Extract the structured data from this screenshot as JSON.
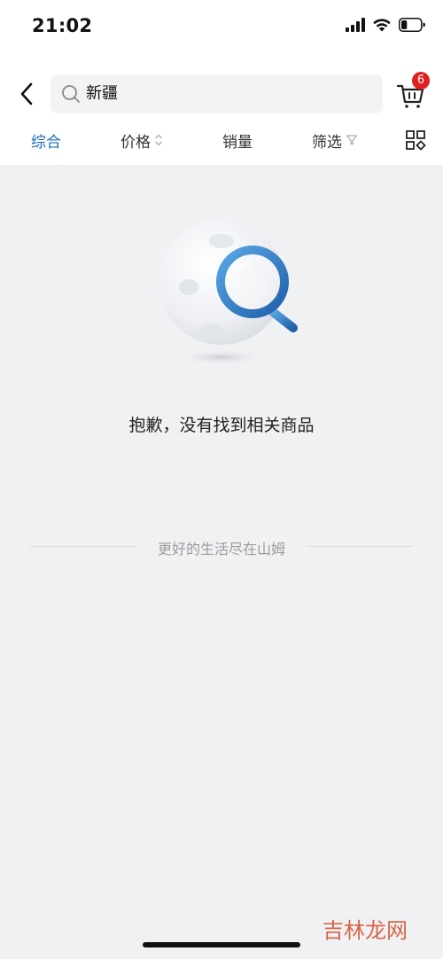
{
  "status_bar": {
    "time": "21:02",
    "icons": [
      "signal-icon",
      "wifi-icon",
      "battery-icon"
    ],
    "battery_level": 0.3
  },
  "search": {
    "query": "新疆",
    "icon": "search-icon"
  },
  "cart": {
    "icon": "cart-icon",
    "badge_count": "6"
  },
  "sort_bar": {
    "items": [
      {
        "label": "综合",
        "active": true
      },
      {
        "label": "价格",
        "icon": "sort-updown-icon"
      },
      {
        "label": "销量"
      },
      {
        "label": "筛选",
        "icon": "filter-icon"
      }
    ],
    "layout_icon": "grid-layout-icon"
  },
  "empty_state": {
    "illustration": "moon-magnifier-illustration",
    "message": "抱歉，没有找到相关商品"
  },
  "footer": {
    "slogan": "更好的生活尽在山姆"
  },
  "watermark": {
    "text": "吉林龙网"
  },
  "colors": {
    "accent": "#1a6fb5",
    "badge": "#e02020",
    "page_background": "#f0f1f3"
  }
}
